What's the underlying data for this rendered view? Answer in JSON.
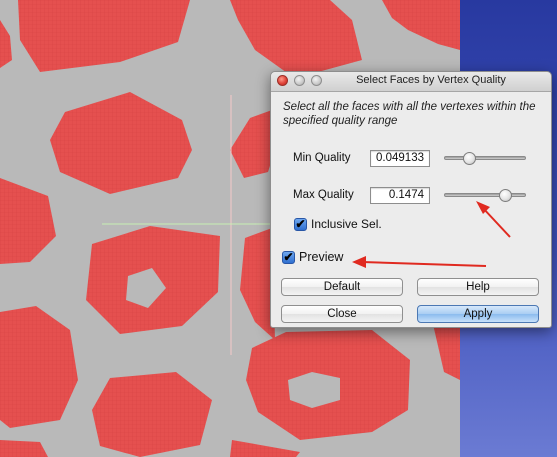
{
  "dialog": {
    "title": "Select Faces by Vertex Quality",
    "description": "Select all the faces with all the vertexes within the specified quality range",
    "min_quality": {
      "label": "Min Quality",
      "value": "0.049133",
      "slider_fraction": 0.27
    },
    "max_quality": {
      "label": "Max Quality",
      "value": "0.1474",
      "slider_fraction": 0.8
    },
    "inclusive": {
      "label": "Inclusive Sel.",
      "checked": true
    },
    "preview": {
      "label": "Preview",
      "checked": true
    },
    "buttons": {
      "default": "Default",
      "help": "Help",
      "close": "Close",
      "apply": "Apply"
    }
  },
  "icons": {
    "window_close": "close-icon",
    "window_minimize": "minimize-icon",
    "window_zoom": "zoom-icon",
    "checkmark": "✔"
  },
  "colors": {
    "mesh_selected": "#e5504f",
    "mesh_background": "#b9b9b9",
    "annotation_arrow": "#e02a20",
    "axis_vertical": "#f5c9c9",
    "axis_horizontal": "#c8f0b4"
  }
}
